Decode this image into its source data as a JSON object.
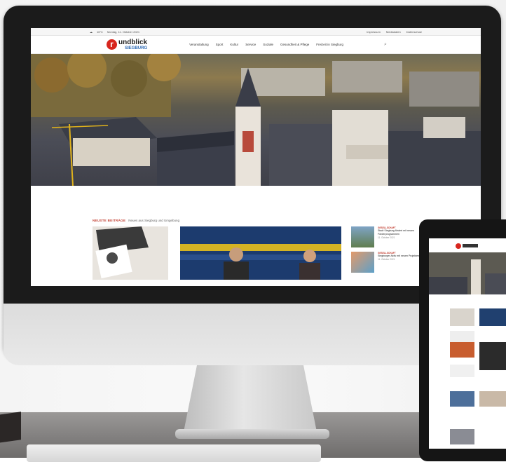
{
  "site": {
    "topbar": {
      "date": "Montag, 11. Oktober 2021",
      "weather": "16°C",
      "links": [
        "Impressum",
        "Mediadaten",
        "Datenschutz"
      ]
    },
    "logo": {
      "main": "undblick",
      "sub": "SIEGBURG",
      "letter": "r"
    },
    "nav": [
      "Veranstaltung",
      "Sport",
      "Kultur",
      "Service",
      "Soziale",
      "Gesundheit & Pflege",
      "Freizeit in Siegburg"
    ],
    "section": {
      "label": "NEUSTE BEITRÄGE",
      "subtitle": "Neues aus Siegburg und Umgebung"
    },
    "side_items": [
      {
        "category": "GESELLSCHAFT",
        "title": "Stadt Siegburg fördert mit neuen Förderprogrammen",
        "date": "11. Oktober 2021"
      },
      {
        "category": "GESELLSCHAFT",
        "title": "Siegburger Aktiv mit neuen Projekten im Herbst",
        "date": "11. Oktober 2021"
      }
    ]
  },
  "colors": {
    "brand_red": "#d7261e",
    "brand_blue": "#2a68b3",
    "device_black": "#1b1b1b"
  }
}
